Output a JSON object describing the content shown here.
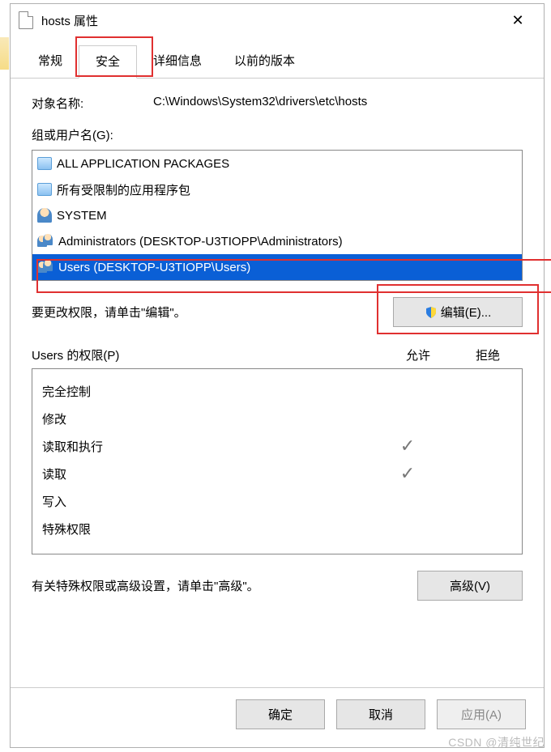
{
  "window": {
    "title": "hosts 属性"
  },
  "tabs": {
    "items": [
      {
        "label": "常规"
      },
      {
        "label": "安全"
      },
      {
        "label": "详细信息"
      },
      {
        "label": "以前的版本"
      }
    ],
    "active_index": 1
  },
  "security": {
    "object_name_label": "对象名称:",
    "object_name_value": "C:\\Windows\\System32\\drivers\\etc\\hosts",
    "groups_label": "组或用户名(G):",
    "groups": [
      {
        "name": "ALL APPLICATION PACKAGES",
        "icon": "pkg"
      },
      {
        "name": "所有受限制的应用程序包",
        "icon": "pkg"
      },
      {
        "name": "SYSTEM",
        "icon": "user"
      },
      {
        "name": "Administrators (DESKTOP-U3TIOPP\\Administrators)",
        "icon": "users"
      },
      {
        "name": "Users (DESKTOP-U3TIOPP\\Users)",
        "icon": "users"
      }
    ],
    "selected_group_index": 4,
    "edit_hint": "要更改权限，请单击\"编辑\"。",
    "edit_button": "编辑(E)...",
    "perm_title": "Users 的权限(P)",
    "allow_label": "允许",
    "deny_label": "拒绝",
    "permissions": [
      {
        "name": "完全控制",
        "allow": false,
        "deny": false
      },
      {
        "name": "修改",
        "allow": false,
        "deny": false
      },
      {
        "name": "读取和执行",
        "allow": true,
        "deny": false
      },
      {
        "name": "读取",
        "allow": true,
        "deny": false
      },
      {
        "name": "写入",
        "allow": false,
        "deny": false
      },
      {
        "name": "特殊权限",
        "allow": false,
        "deny": false
      }
    ],
    "advanced_hint": "有关特殊权限或高级设置，请单击\"高级\"。",
    "advanced_button": "高级(V)"
  },
  "footer": {
    "ok": "确定",
    "cancel": "取消",
    "apply": "应用(A)"
  },
  "watermark": "CSDN @清纯世纪"
}
